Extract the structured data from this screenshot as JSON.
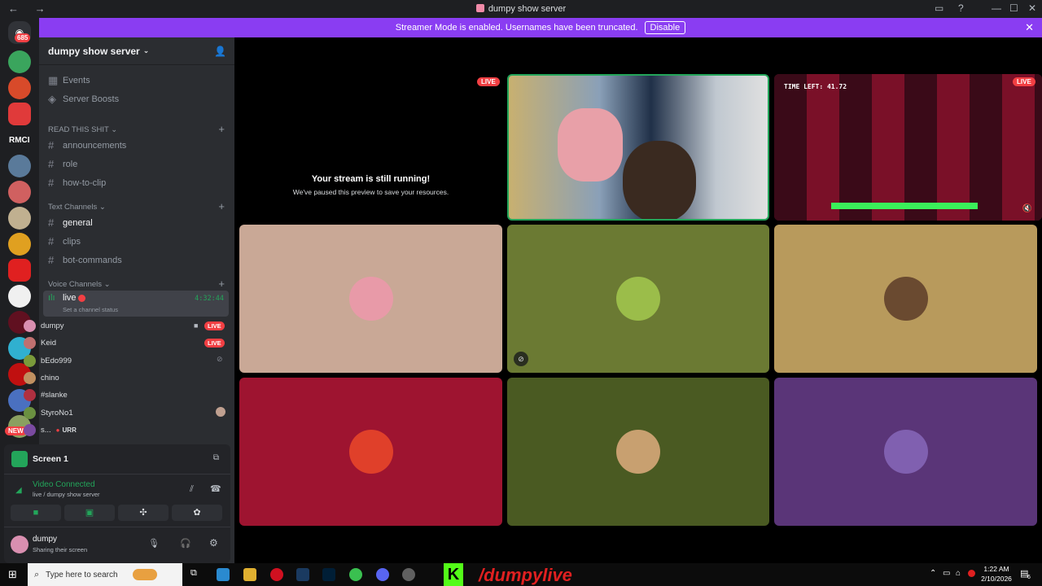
{
  "window": {
    "title": "dumpy show server",
    "nav": "← →"
  },
  "banner": {
    "text": "Streamer Mode is enabled. Usernames have been truncated.",
    "button": "Disable"
  },
  "servers": {
    "badge_top": "685",
    "rmc_label": "RMCI",
    "new_badge": "NEW"
  },
  "server": {
    "name": "dumpy show server"
  },
  "sidebar": {
    "events": "Events",
    "boosts": "Server Boosts",
    "cat_read": "READ THIS SHIT",
    "read_channels": [
      "announcements",
      "role",
      "how-to-clip"
    ],
    "cat_text": "Text Channels",
    "text_channels": [
      "general",
      "clips",
      "bot-commands"
    ],
    "cat_voice": "Voice Channels",
    "voice_channel": {
      "name": "live",
      "timer": "4:32:44",
      "status": "Set a channel status"
    },
    "voice_users": [
      {
        "name": "dumpy",
        "badge": "LIVE",
        "color": "#d98fb0"
      },
      {
        "name": "Keid",
        "badge": "LIVE",
        "color": "#c07070"
      },
      {
        "name": "bEdo999",
        "badge": "",
        "color": "#7a9a3a"
      },
      {
        "name": "chino",
        "badge": "",
        "color": "#c09060"
      },
      {
        "name": "#slanke",
        "badge": "",
        "color": "#b03040"
      },
      {
        "name": "StyroNo1",
        "badge": "",
        "color": "#6a9040"
      },
      {
        "name": "s...",
        "badge": "URR",
        "color": "#7a4aa0"
      }
    ]
  },
  "panel": {
    "screen_label": "Screen 1",
    "video_connected": "Video Connected",
    "video_sub": "live / dumpy show server",
    "username": "dumpy",
    "user_status": "Sharing their screen"
  },
  "stage": {
    "paused_title": "Your stream is still running!",
    "paused_sub": "We've paused this preview to save your resources.",
    "live_label": "LIVE",
    "game_hud": "TIME LEFT: 41.72",
    "tiles": [
      {
        "bg": "#c9a896",
        "avatar": "#e89aa8"
      },
      {
        "bg": "#6b7a33",
        "avatar": "#9bbd4a"
      },
      {
        "bg": "#b89a5c",
        "avatar": "#6a4a30"
      },
      {
        "bg": "#9e1430",
        "avatar": "#e0402a"
      },
      {
        "bg": "#4a5a22",
        "avatar": "#c8a070"
      },
      {
        "bg": "#5a3578",
        "avatar": "#8060b0"
      }
    ]
  },
  "taskbar": {
    "search_placeholder": "Type here to search",
    "time": "1:22 AM",
    "date": "2/10/2026",
    "overlay_text": "/dumpylive",
    "notif": "6"
  }
}
